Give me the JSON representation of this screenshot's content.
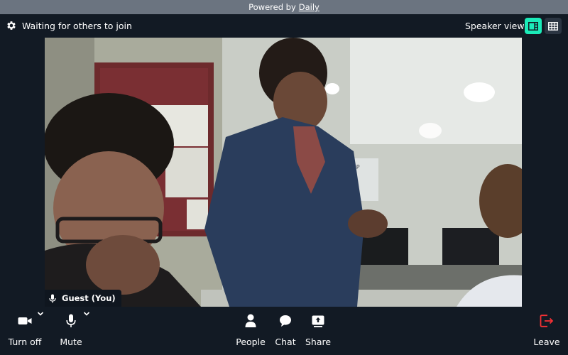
{
  "powered": {
    "prefix": "Powered by",
    "link": "Daily"
  },
  "header": {
    "status": "Waiting for others to join",
    "view_label": "Speaker view",
    "active_view": "speaker"
  },
  "participant": {
    "name": "Guest (You)"
  },
  "tray": {
    "camera_label": "Turn off",
    "mic_label": "Mute",
    "people_label": "People",
    "chat_label": "Chat",
    "share_label": "Share",
    "leave_label": "Leave"
  },
  "colors": {
    "background": "#121a24",
    "accent": "#1bebb9",
    "leave": "#f63135",
    "powered_bar": "#6b7480"
  },
  "icons": [
    "gear-icon",
    "speaker-view-icon",
    "grid-view-icon",
    "microphone-icon",
    "camera-icon",
    "chevron-down-icon",
    "people-icon",
    "chat-icon",
    "share-icon",
    "leave-icon"
  ]
}
